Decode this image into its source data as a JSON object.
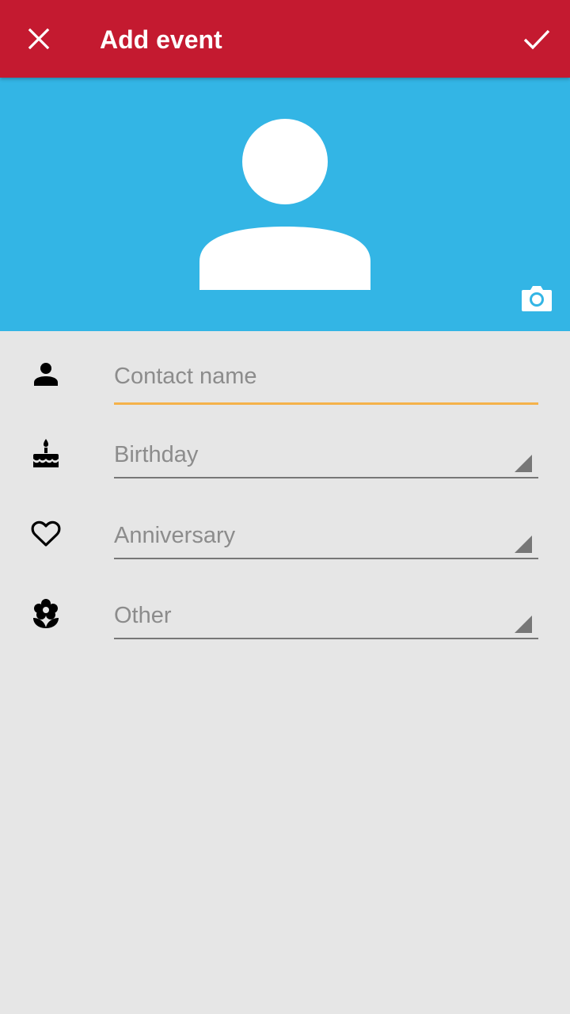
{
  "toolbar": {
    "title": "Add event",
    "close_icon": "close-icon",
    "done_icon": "check-icon",
    "background": "#c41a30"
  },
  "photo": {
    "background": "#33b5e5",
    "avatar_icon": "person-silhouette-icon",
    "camera_icon": "camera-icon"
  },
  "form": {
    "contact_name": {
      "icon": "person-icon",
      "placeholder": "Contact name",
      "value": ""
    },
    "birthday": {
      "icon": "cake-icon",
      "label": "Birthday"
    },
    "anniversary": {
      "icon": "heart-outline-icon",
      "label": "Anniversary"
    },
    "other": {
      "icon": "flower-icon",
      "label": "Other"
    }
  },
  "colors": {
    "focus_underline": "#f5b24a",
    "inactive_underline": "#777777",
    "hint_text": "#8c8c8c"
  }
}
